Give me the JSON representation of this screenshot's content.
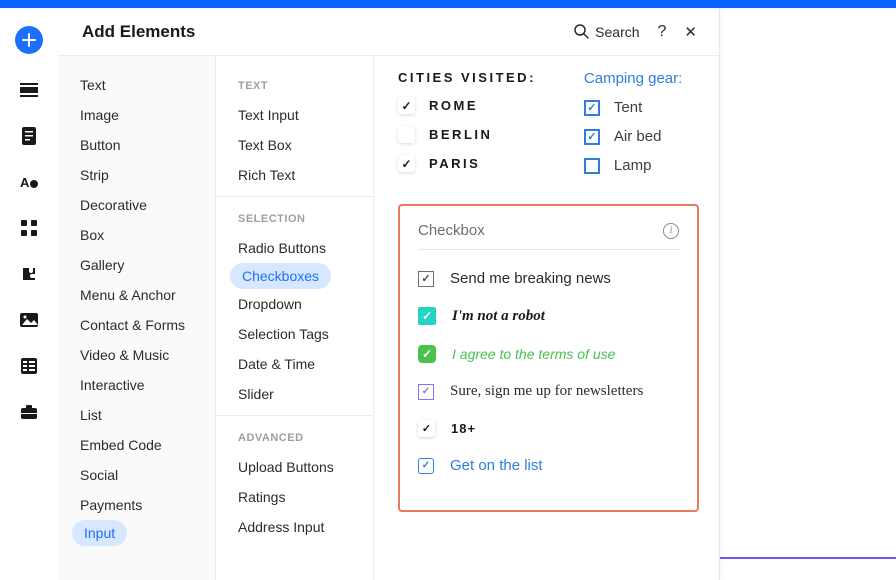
{
  "header": {
    "title": "Add Elements",
    "search_label": "Search",
    "help_label": "?",
    "close_label": "✕"
  },
  "col1": {
    "items": [
      "Text",
      "Image",
      "Button",
      "Strip",
      "Decorative",
      "Box",
      "Gallery",
      "Menu & Anchor",
      "Contact & Forms",
      "Video & Music",
      "Interactive",
      "List",
      "Embed Code",
      "Social",
      "Payments",
      "Input"
    ],
    "selected_index": 15
  },
  "col2": {
    "groups": [
      {
        "header": "TEXT",
        "items": [
          "Text Input",
          "Text Box",
          "Rich Text"
        ]
      },
      {
        "header": "SELECTION",
        "items": [
          "Radio Buttons",
          "Checkboxes",
          "Dropdown",
          "Selection Tags",
          "Date & Time",
          "Slider"
        ],
        "selected_index": 1
      },
      {
        "header": "ADVANCED",
        "items": [
          "Upload Buttons",
          "Ratings",
          "Address Input"
        ]
      }
    ]
  },
  "examples": {
    "visited": {
      "title": "CITIES VISITED:",
      "items": [
        {
          "label": "ROME",
          "checked": true
        },
        {
          "label": "BERLIN",
          "checked": false
        },
        {
          "label": "PARIS",
          "checked": true
        }
      ]
    },
    "camping": {
      "title": "Camping gear:",
      "items": [
        {
          "label": "Tent",
          "checked": true
        },
        {
          "label": "Air bed",
          "checked": true
        },
        {
          "label": "Lamp",
          "checked": false
        }
      ]
    },
    "checkbox_section": {
      "title": "Checkbox",
      "items": [
        "Send me breaking news",
        "I'm not a robot",
        "I agree to the terms of use",
        "Sure, sign me up for newsletters",
        "18+",
        "Get on the list"
      ]
    }
  }
}
